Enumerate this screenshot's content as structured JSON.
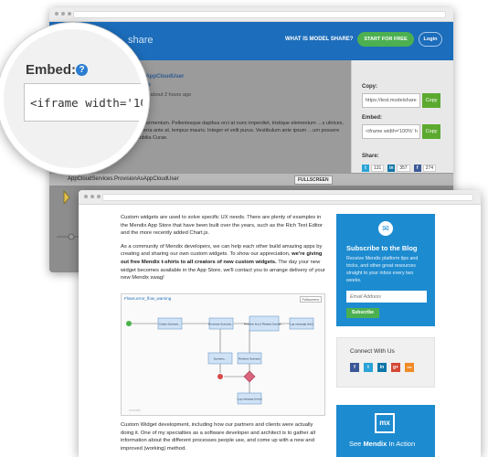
{
  "back_window": {
    "header": {
      "logo_text": "share",
      "what_link": "WHAT IS MODEL SHARE?",
      "start_button": "START FOR FREE",
      "login_button": "Login"
    },
    "model": {
      "link1": "…sAppCloudUser",
      "link2": "…nts",
      "meta": "…15, about 2 hours ago",
      "description": "…t fermentum. Pellentesque dapibus orci at nunc imperdiet, tristique elementum …s ultrices, viverra ante at, tempus mauris. Integer et velit purus. Vestibulum ante ipsum …um posuere cubilia Curae."
    },
    "side": {
      "copy_label": "Copy:",
      "copy_value": "https://test.modelshare",
      "copy_button": "Copy",
      "embed_label": "Embed:",
      "embed_value": "<iframe width='100%' h",
      "embed_button": "Copy",
      "share_label": "Share:",
      "share_counts": [
        "131",
        "357",
        "274"
      ]
    },
    "app_bar": {
      "title": "AppCloudServices.ProvisionAsAppCloudUser",
      "fullscreen_button": "FULLSCREEN"
    }
  },
  "magnifier": {
    "label": "Embed:",
    "help_icon": "?",
    "field_value": "<iframe width='100"
  },
  "front_window": {
    "blog": {
      "p1": "Custom widgets are used to solve specific UX needs. There are plenty of examples in the Mendix App Store that have been built over the years, such as the Rich Text Editor and the more recently added Chart.js.",
      "p2_plain": "As a community of Mendix developers, we can help each other build amazing apps by creating and sharing our own custom widgets. To show our appreciation,",
      "p2_bold": "we're giving out free Mendix t-shirts to all creators of new custom widgets.",
      "p2_tail": "The day your new widget becomes available in the App Store, we'll contact you to arrange delivery of your new Mendix swag!",
      "p3": "Custom Widget development, including how our partners and clients were actually doing it. One of my specialties as a software developer and architect is to gather all information about the different processes people use, and come up with a new and improved (working) method."
    },
    "flow": {
      "title": "Flows.error_flow_warning",
      "fullscreen": "Fullscreen",
      "watermark": "mendix",
      "nodes": [
        "Create Scenario…",
        "Generate Scenario…",
        "Retrieve list of Related Scenari…",
        "Log message (info)",
        "Scenario…",
        "Retrieve Scenario",
        "Log message (error)"
      ]
    },
    "subscribe": {
      "title": "Subscribe to the Blog",
      "text": "Receive Mendix platform tips and tricks, and other great resources straight to your inbox every two weeks.",
      "placeholder": "Email Address",
      "button": "Subscribe"
    },
    "connect": {
      "title": "Connect With Us",
      "icons": [
        "f",
        "t",
        "in",
        "g+",
        "rss"
      ]
    },
    "mx_banner": {
      "logo": "mx",
      "text_plain": "See ",
      "text_bold": "Mendix",
      "text_tail": " In Action"
    }
  },
  "colors": {
    "brand_blue": "#1c6dbb",
    "accent_blue": "#1d8bd0",
    "green": "#4cb050",
    "copy_green": "#5ca930"
  }
}
